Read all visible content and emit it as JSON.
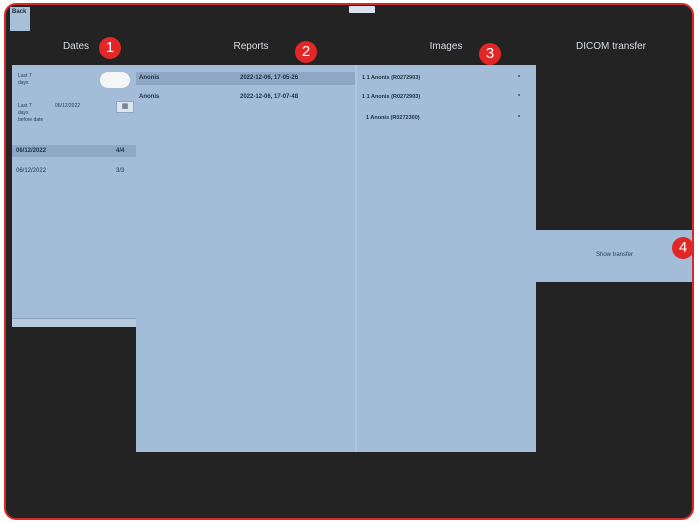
{
  "header": {
    "back_label": "Back",
    "tabs": [
      {
        "label": "Dates"
      },
      {
        "label": "Reports"
      },
      {
        "label": "Images"
      },
      {
        "label": "DICOM transfer"
      }
    ]
  },
  "callouts": [
    "1",
    "2",
    "3",
    "4"
  ],
  "dates": {
    "last7_label_a": "Last 7",
    "last7_label_b": "days",
    "last7_2_label_a": "Last 7",
    "last7_2_label_b": "days",
    "before_date_label": "before date",
    "before_date_value": "06/12/2022",
    "calendar_icon": "calendar-icon",
    "rows": [
      {
        "date": "06/12/2022",
        "count": "4/4",
        "selected": true
      },
      {
        "date": "06/12/2022",
        "count": "3/3",
        "selected": false
      }
    ]
  },
  "reports": {
    "rows": [
      {
        "name": "Anonis",
        "datetime": "2022-12-06, 17-05-26",
        "selected": true
      },
      {
        "name": "Anonis",
        "datetime": "2022-12-06, 17-07-48",
        "selected": false
      }
    ]
  },
  "images": {
    "rows": [
      {
        "label": "1 1 Anonis (R0272903)",
        "marker": "*"
      },
      {
        "label": "1 1 Anonis (R0272903)",
        "marker": "*"
      },
      {
        "label": "1 Anonis (R0272300)",
        "marker": "*"
      }
    ]
  },
  "dicom": {
    "button_label": "Show transfer"
  }
}
